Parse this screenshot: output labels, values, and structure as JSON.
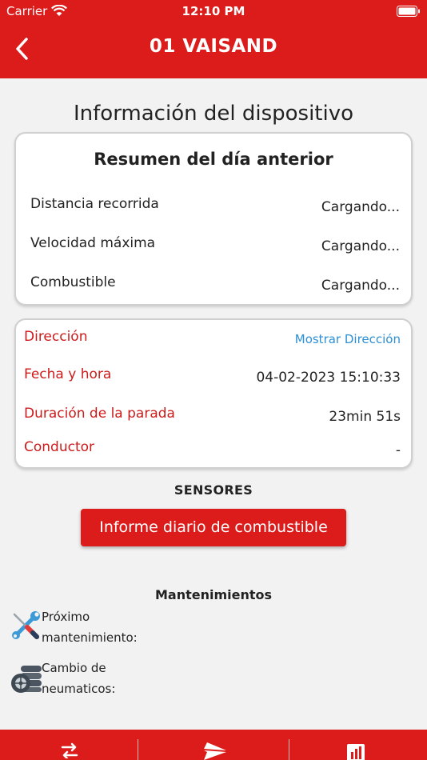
{
  "status_bar": {
    "carrier": "Carrier",
    "time": "12:10 PM"
  },
  "header": {
    "title": "01 VAISAND"
  },
  "section_title": "Información del dispositivo",
  "summary": {
    "title": "Resumen del día anterior",
    "rows": [
      {
        "label": "Distancia recorrida",
        "value": "Cargando..."
      },
      {
        "label": "Velocidad máxima",
        "value": "Cargando..."
      },
      {
        "label": "Combustible",
        "value": "Cargando..."
      }
    ]
  },
  "details": {
    "rows": [
      {
        "label": "Dirección",
        "value": "Mostrar Dirección"
      },
      {
        "label": "Fecha y hora",
        "value": "04-02-2023 15:10:33"
      },
      {
        "label": "Duración de la parada",
        "value": "23min 51s"
      },
      {
        "label": "Conductor",
        "value": "-"
      }
    ]
  },
  "sensors": {
    "title": "SENSORES",
    "button_label": "Informe diario de combustible"
  },
  "maintenance": {
    "title": "Mantenimientos",
    "items": [
      {
        "line1": "Próximo",
        "line2": "mantenimiento:",
        "icon": "wrench-screwdriver-icon"
      },
      {
        "line1": "Cambio de",
        "line2": "neumaticos:",
        "icon": "tires-icon"
      }
    ]
  },
  "tab_bar": {
    "icons": [
      "swap-arrows-icon",
      "send-icon",
      "bar-chart-icon"
    ]
  },
  "colors": {
    "primary": "#dc1b1b",
    "link": "#2d8fd6",
    "background": "#f2f2f2"
  }
}
